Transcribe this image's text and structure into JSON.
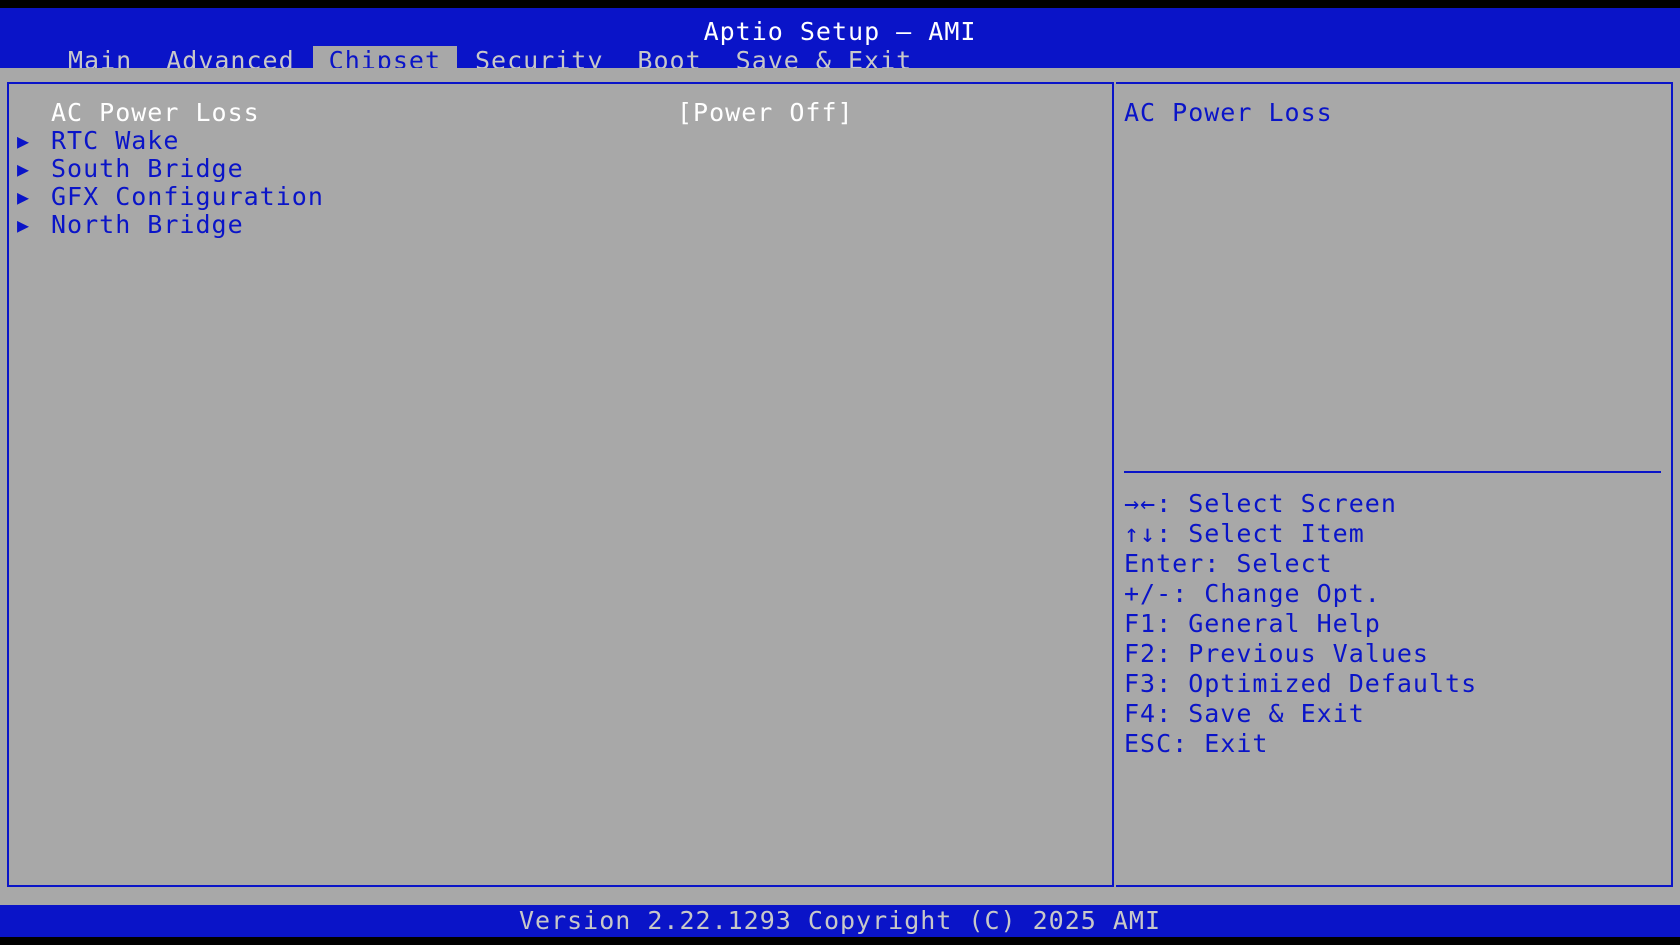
{
  "window": {
    "title": "Aptio Setup – AMI"
  },
  "tabs": [
    {
      "label": "Main"
    },
    {
      "label": "Advanced"
    },
    {
      "label": "Chipset"
    },
    {
      "label": "Security"
    },
    {
      "label": "Boot"
    },
    {
      "label": "Save & Exit"
    }
  ],
  "active_tab": "Chipset",
  "menu": {
    "items": [
      {
        "label": "AC Power Loss",
        "value": "[Power Off]",
        "submenu": false
      },
      {
        "label": "RTC Wake",
        "submenu": true
      },
      {
        "label": "South Bridge",
        "submenu": true
      },
      {
        "label": "GFX Configuration",
        "submenu": true
      },
      {
        "label": "North Bridge",
        "submenu": true
      }
    ],
    "submenu_arrow_icon": "triangle-right-icon"
  },
  "help": {
    "title": "AC Power Loss",
    "keys": [
      "→←: Select Screen",
      "↑↓: Select Item",
      "Enter: Select",
      "+/-: Change Opt.",
      "F1: General Help",
      "F2: Previous Values",
      "F3: Optimized Defaults",
      "F4: Save & Exit",
      "ESC: Exit"
    ]
  },
  "footer": {
    "text": "Version 2.22.1293 Copyright (C) 2025 AMI"
  },
  "colors": {
    "blue": "#0a14c8",
    "panel_gray": "#a8a8a8",
    "inactive_tab_text": "#c8c8c8",
    "highlight_text": "#ffffff"
  }
}
